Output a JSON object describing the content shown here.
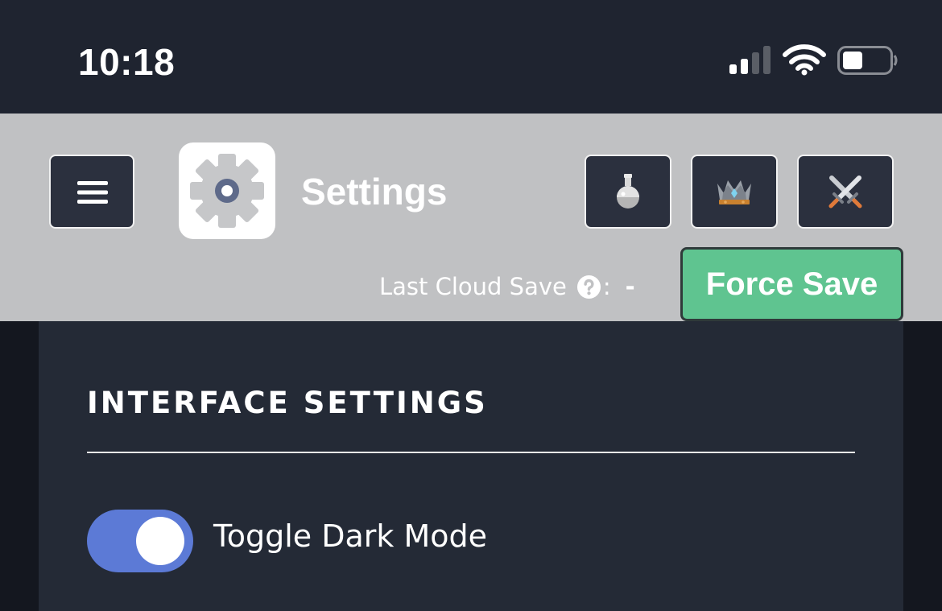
{
  "status_bar": {
    "time": "10:18",
    "icons": [
      "cellular-signal-icon",
      "wifi-icon",
      "battery-icon"
    ]
  },
  "header": {
    "menu_icon": "hamburger-menu-icon",
    "logo_icon": "gear-icon",
    "title": "Settings",
    "nav_buttons": [
      {
        "icon": "potion-flask-icon"
      },
      {
        "icon": "crown-icon"
      },
      {
        "icon": "crossed-swords-icon"
      }
    ],
    "cloud_save_label": "Last Cloud Save",
    "cloud_save_colon": ":",
    "cloud_save_value": "-",
    "help_icon": "question-circle-icon",
    "force_save_label": "Force Save"
  },
  "settings": {
    "section_title": "INTERFACE SETTINGS",
    "toggles": [
      {
        "label": "Toggle Dark Mode",
        "checked": true
      }
    ]
  },
  "colors": {
    "status_bar_bg": "#1f2430",
    "header_bg": "#c0c1c3",
    "button_bg": "#2b303e",
    "force_save": "#5fc490",
    "panel_bg": "#242a36",
    "toggle_on": "#5c7ad6"
  }
}
